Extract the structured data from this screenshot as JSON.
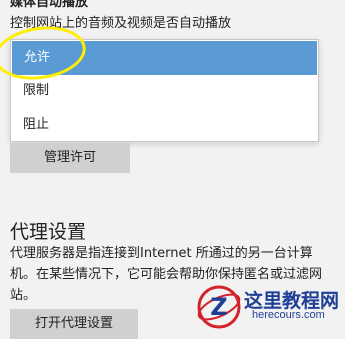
{
  "media_autoplay": {
    "title": "媒体自动播放",
    "description": "控制网站上的音频及视频是否自动播放",
    "options": [
      {
        "label": "允许",
        "selected": true
      },
      {
        "label": "限制",
        "selected": false
      },
      {
        "label": "阻止",
        "selected": false
      }
    ],
    "manage_button": "管理许可"
  },
  "proxy": {
    "title": "代理设置",
    "description": "代理服务器是指连接到Internet 所通过的另一台计算机。在某些情况下，它可能会帮助你保持匿名或过滤网站。",
    "open_button": "打开代理设置"
  },
  "watermark": {
    "brand": "这里教程网",
    "url": "herecours.com",
    "logo_letter": "Z"
  },
  "colors": {
    "selected": "#5a9bd5",
    "highlight": "#ffee00",
    "watermark": "#1f3f96",
    "watermark_accent": "#d2232a"
  }
}
